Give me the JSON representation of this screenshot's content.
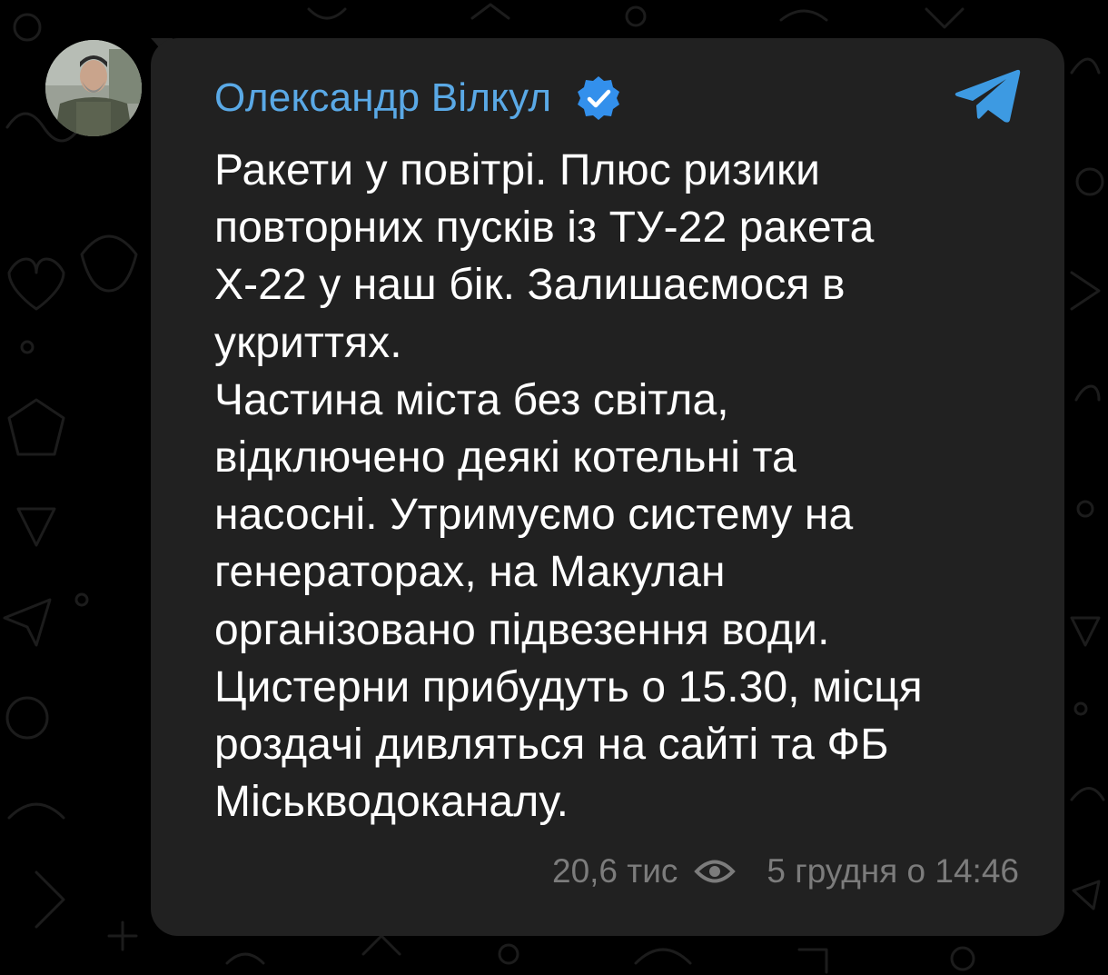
{
  "post": {
    "author": "Олександр Вілкул",
    "text": "Ракети у повітрі. Плюс ризики\nповторних пусків із ТУ-22 ракета\nХ-22 у наш бік. Залишаємося в\nукриттях.\nЧастина міста без світла,\nвідключено деякі котельні та\nнасосні. Утримуємо систему на\nгенераторах, на Макулан\nорганізовано підвезення води.\nЦистерни прибудуть о 15.30, місця\nроздачі дивляться на сайті та ФБ\nМіськводоканалу.",
    "views": "20,6 тис",
    "timestamp": "5 грудня о 14:46"
  },
  "icons": {
    "verified": "verified-badge-icon",
    "app": "telegram-icon",
    "views": "eye-icon"
  },
  "colors": {
    "background": "#000000",
    "bubble": "#212121",
    "author": "#5aa9e6",
    "accent": "#3390ec",
    "text": "#ffffff",
    "meta": "#7c7c7c"
  }
}
